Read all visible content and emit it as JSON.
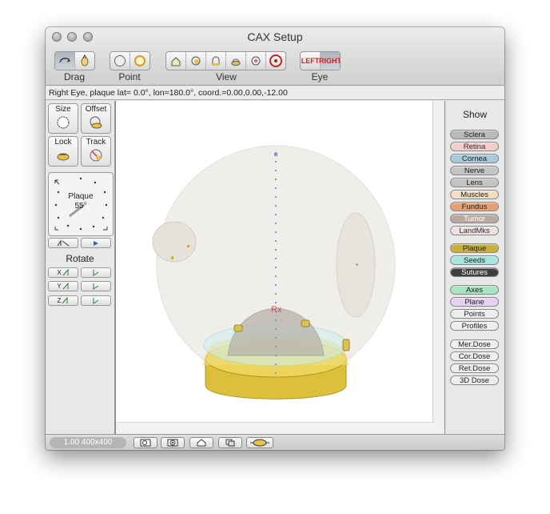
{
  "window": {
    "title": "CAX Setup"
  },
  "toolbar": {
    "groups": [
      {
        "label": "Drag",
        "buttons": [
          "rotate-drag-icon",
          "hand-drag-icon"
        ]
      },
      {
        "label": "Point",
        "buttons": [
          "point-globe-icon",
          "point-target-icon"
        ]
      },
      {
        "label": "View",
        "buttons": [
          "view-top-icon",
          "view-front-icon",
          "view-side-icon",
          "view-bottom-icon",
          "view-oblique-icon",
          "view-eye-icon"
        ]
      },
      {
        "label": "Eye",
        "buttons": [
          "LEFT",
          "RIGHT"
        ]
      }
    ]
  },
  "status": {
    "text": "Right Eye, plaque lat=  0.0°, lon=180.0°, coord.=0.00,0.00,-12.00"
  },
  "left_panel": {
    "tools": [
      {
        "label": "Size",
        "icon": "size-circle-icon"
      },
      {
        "label": "Offset",
        "icon": "offset-icon"
      },
      {
        "label": "Lock",
        "icon": "lock-icon"
      },
      {
        "label": "Track",
        "icon": "track-icon"
      }
    ],
    "plaque": {
      "label": "Plaque",
      "angle": "55°"
    },
    "rotate_label": "Rotate",
    "axes": [
      "X",
      "Y",
      "Z"
    ]
  },
  "viewport": {
    "center_label": "Rx"
  },
  "show_panel": {
    "title": "Show",
    "toggles": [
      {
        "label": "Sclera",
        "color": "#b9b9b9",
        "text": "#222222"
      },
      {
        "label": "Retina",
        "color": "#f3cccc",
        "text": "#333333"
      },
      {
        "label": "Cornea",
        "color": "#a7c9d8",
        "text": "#222222"
      },
      {
        "label": "Nerve",
        "color": "#c4c4c4",
        "text": "#222222"
      },
      {
        "label": "Lens",
        "color": "#c4c4c4",
        "text": "#222222"
      },
      {
        "label": "Muscles",
        "color": "#f0dfc3",
        "text": "#222222"
      },
      {
        "label": "Fundus",
        "color": "#e7a071",
        "text": "#222222"
      },
      {
        "label": "Tumor",
        "color": "#b9a9a2",
        "text": "#ffffff"
      },
      {
        "label": "LandMks",
        "color": "#f0e1e1",
        "text": "#333333"
      },
      {
        "label": "Plaque",
        "color": "#c9b03a",
        "text": "#222222"
      },
      {
        "label": "Seeds",
        "color": "#a8e4e0",
        "text": "#222222"
      },
      {
        "label": "Sutures",
        "color": "#3e3e3e",
        "text": "#ffffff"
      },
      {
        "label": "Axes",
        "color": "#a7e5c0",
        "text": "#222222"
      },
      {
        "label": "Plane",
        "color": "#e4d1f3",
        "text": "#222222"
      },
      {
        "label": "Points",
        "color": "#eeeeee",
        "text": "#222222"
      },
      {
        "label": "Profiles",
        "color": "#eeeeee",
        "text": "#222222"
      },
      {
        "label": "Mer.Dose",
        "color": "#eeeeee",
        "text": "#222222"
      },
      {
        "label": "Cor.Dose",
        "color": "#eeeeee",
        "text": "#222222"
      },
      {
        "label": "Ret.Dose",
        "color": "#eeeeee",
        "text": "#222222"
      },
      {
        "label": "3D Dose",
        "color": "#eeeeee",
        "text": "#222222"
      }
    ]
  },
  "bottom": {
    "zoom": "1.00 400x400",
    "buttons": [
      "zoom-out-icon",
      "zoom-in-icon",
      "home-icon",
      "copy-icon",
      "plaque-view-icon"
    ]
  }
}
